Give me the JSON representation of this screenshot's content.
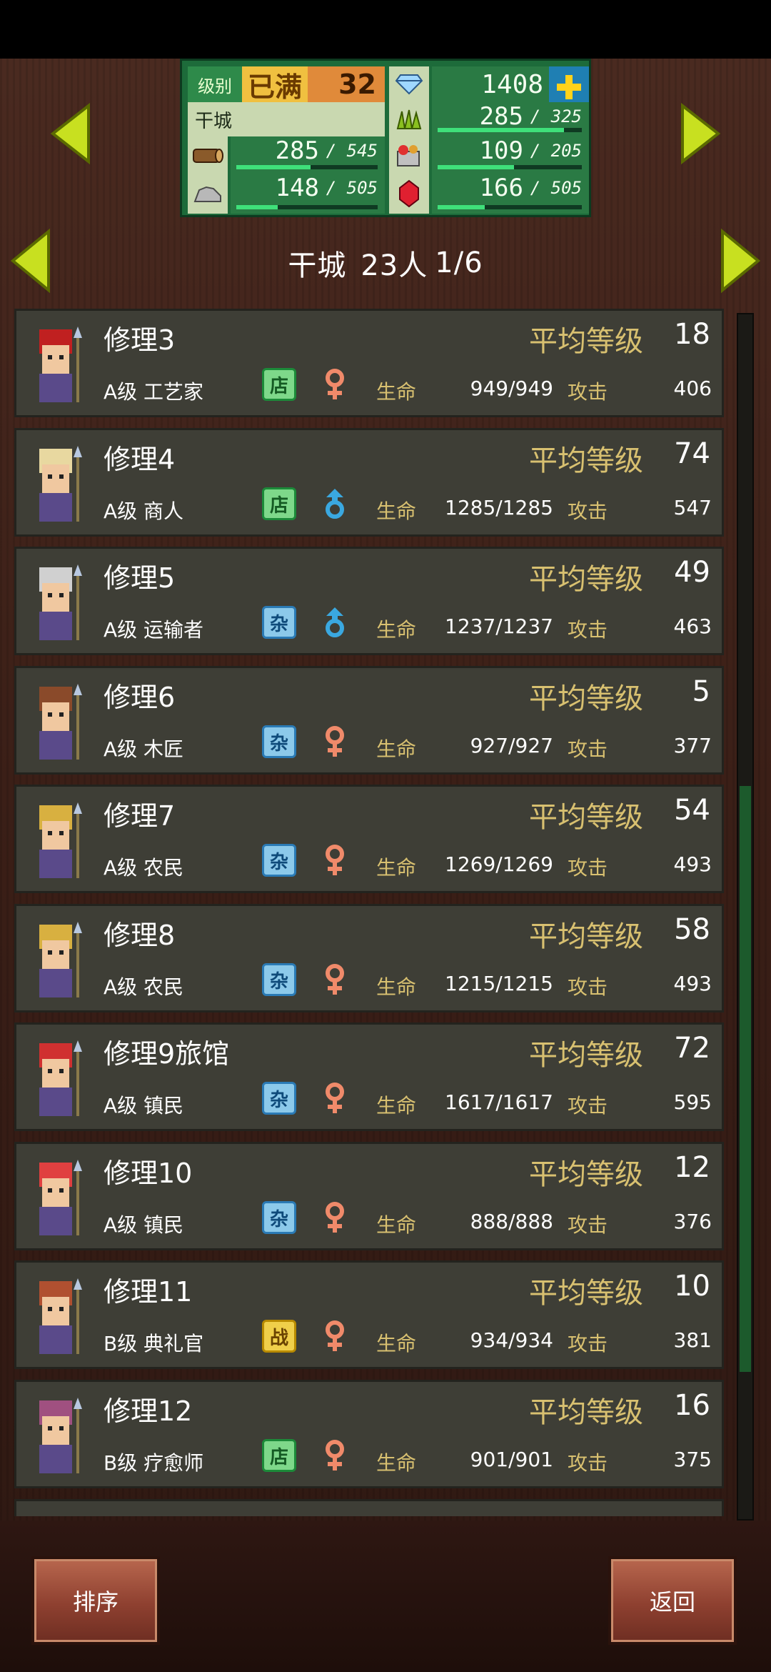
{
  "status": {
    "level_label": "级别",
    "level_max": "已满",
    "level": "32",
    "gems": "1408",
    "castle_name": "干城",
    "resources": [
      {
        "icon": "grass-icon",
        "value": "285",
        "cap": "/ 325",
        "fill": 0.877
      },
      {
        "icon": "wood-icon",
        "value": "285",
        "cap": "/ 545",
        "fill": 0.523
      },
      {
        "icon": "food-icon",
        "value": "109",
        "cap": "/ 205",
        "fill": 0.532
      },
      {
        "icon": "stone-icon",
        "value": "148",
        "cap": "/ 505",
        "fill": 0.293
      },
      {
        "icon": "ruby-icon",
        "value": "166",
        "cap": "/ 505",
        "fill": 0.329
      }
    ]
  },
  "header": {
    "castle": "干城",
    "count": "23人",
    "page": "1/6"
  },
  "labels": {
    "avg_level": "平均等级",
    "hp": "生命",
    "attack": "攻击"
  },
  "residents": [
    {
      "name": "修理3",
      "rank": "A级 工艺家",
      "tag": "店",
      "tag_type": "shop",
      "gender": "female",
      "avg": "18",
      "hp": "949/949",
      "atk": "406"
    },
    {
      "name": "修理4",
      "rank": "A级 商人",
      "tag": "店",
      "tag_type": "shop",
      "gender": "male",
      "avg": "74",
      "hp": "1285/1285",
      "atk": "547"
    },
    {
      "name": "修理5",
      "rank": "A级 运输者",
      "tag": "杂",
      "tag_type": "misc",
      "gender": "male",
      "avg": "49",
      "hp": "1237/1237",
      "atk": "463"
    },
    {
      "name": "修理6",
      "rank": "A级 木匠",
      "tag": "杂",
      "tag_type": "misc",
      "gender": "female",
      "avg": "5",
      "hp": "927/927",
      "atk": "377"
    },
    {
      "name": "修理7",
      "rank": "A级 农民",
      "tag": "杂",
      "tag_type": "misc",
      "gender": "female",
      "avg": "54",
      "hp": "1269/1269",
      "atk": "493"
    },
    {
      "name": "修理8",
      "rank": "A级 农民",
      "tag": "杂",
      "tag_type": "misc",
      "gender": "female",
      "avg": "58",
      "hp": "1215/1215",
      "atk": "493"
    },
    {
      "name": "修理9旅馆",
      "rank": "A级 镇民",
      "tag": "杂",
      "tag_type": "misc",
      "gender": "female",
      "avg": "72",
      "hp": "1617/1617",
      "atk": "595"
    },
    {
      "name": "修理10",
      "rank": "A级 镇民",
      "tag": "杂",
      "tag_type": "misc",
      "gender": "female",
      "avg": "12",
      "hp": "888/888",
      "atk": "376"
    },
    {
      "name": "修理11",
      "rank": "B级 典礼官",
      "tag": "战",
      "tag_type": "war",
      "gender": "female",
      "avg": "10",
      "hp": "934/934",
      "atk": "381"
    },
    {
      "name": "修理12",
      "rank": "B级 疗愈师",
      "tag": "店",
      "tag_type": "shop",
      "gender": "female",
      "avg": "16",
      "hp": "901/901",
      "atk": "375"
    }
  ],
  "buttons": {
    "sort": "排序",
    "back": "返回"
  },
  "colors": {
    "panel_green": "#1d6b3a",
    "card_bg": "#3e3e36",
    "label_gold": "#d8c070",
    "arrow_yellow": "#c8e020"
  }
}
